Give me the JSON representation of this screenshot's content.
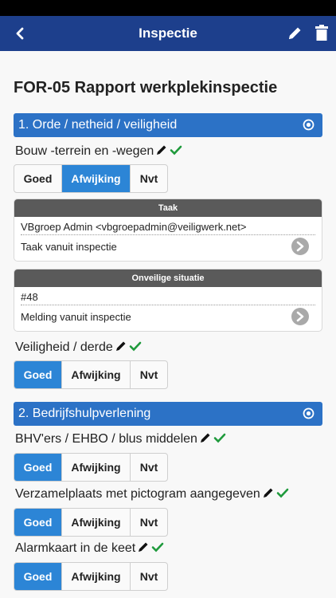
{
  "nav": {
    "title": "Inspectie",
    "back_icon": "chevron-left-icon",
    "edit_icon": "pencil-icon",
    "delete_icon": "trash-icon"
  },
  "report_title": "FOR-05 Rapport werkplekinspectie",
  "options": {
    "good": "Goed",
    "deviation": "Afwijking",
    "na": "Nvt"
  },
  "sections": [
    {
      "title": "1. Orde / netheid / veiligheid",
      "items": [
        {
          "label": "Bouw -terrein en -wegen",
          "selected": "Afwijking"
        },
        {
          "label": "Veiligheid / derde",
          "selected": "Goed"
        }
      ]
    },
    {
      "title": "2. Bedrijfshulpverlening",
      "items": [
        {
          "label": "BHV'ers / EHBO / blus middelen",
          "selected": "Goed"
        },
        {
          "label": "Verzamelplaats met pictogram aangegeven",
          "selected": "Goed"
        },
        {
          "label": "Alarmkaart in de keet",
          "selected": "Goed"
        }
      ]
    }
  ],
  "task_card": {
    "header": "Taak",
    "assignee": "VBgroep Admin <vbgroepadmin@veiligwerk.net>",
    "description": "Taak vanuit inspectie"
  },
  "unsafe_card": {
    "header": "Onveilige situatie",
    "number": "#48",
    "description": "Melding vanuit inspectie"
  },
  "colors": {
    "navbar": "#1d3f8c",
    "section_header": "#2c72c6",
    "active_option": "#2c85d6",
    "check": "#1f9a3c"
  }
}
